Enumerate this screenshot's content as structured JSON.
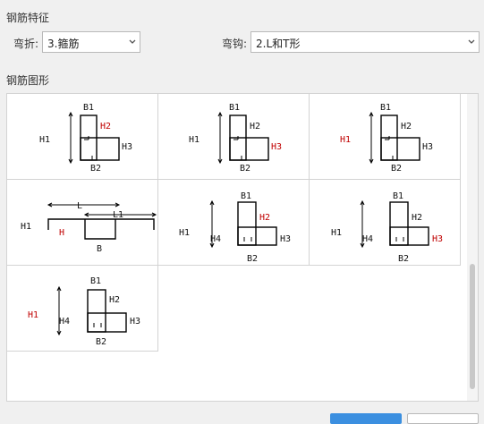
{
  "sections": {
    "features_title": "钢筋特征",
    "shapes_title": "钢筋图形"
  },
  "bend": {
    "label": "弯折:",
    "value": "3.箍筋"
  },
  "hook": {
    "label": "弯钩:",
    "value": "2.L和T形"
  },
  "shapes": [
    {
      "id": "shape-1",
      "labels": {
        "h1": "H1",
        "b1": "B1",
        "h2": "H2",
        "h3": "H3",
        "b2": "B2"
      },
      "red": "H2"
    },
    {
      "id": "shape-2",
      "labels": {
        "h1": "H1",
        "b1": "B1",
        "h2": "H2",
        "h3": "H3",
        "b2": "B2"
      },
      "red": "H3"
    },
    {
      "id": "shape-3",
      "labels": {
        "h1": "H1",
        "b1": "B1",
        "h2": "H2",
        "h3": "H3",
        "b2": "B2"
      },
      "red": "H1"
    },
    {
      "id": "shape-4",
      "labels": {
        "h1": "H1",
        "l": "L",
        "l1": "L1",
        "h": "H",
        "b": "B"
      },
      "red": "H"
    },
    {
      "id": "shape-5",
      "labels": {
        "h1": "H1",
        "h4": "H4",
        "b1": "B1",
        "h2": "H2",
        "h3": "H3",
        "b2": "B2"
      },
      "red": "H2"
    },
    {
      "id": "shape-6",
      "labels": {
        "h1": "H1",
        "h4": "H4",
        "b1": "B1",
        "h2": "H2",
        "h3": "H3",
        "b2": "B2"
      },
      "red": "H3"
    },
    {
      "id": "shape-7",
      "labels": {
        "h1": "H1",
        "h4": "H4",
        "b1": "B1",
        "h2": "H2",
        "h3": "H3",
        "b2": "B2"
      },
      "red": "H1"
    }
  ],
  "colors": {
    "highlight_label": "#c00000",
    "primary_button": "#3b8fe0"
  },
  "icons": {
    "dropdown": "chevron-down-icon"
  }
}
